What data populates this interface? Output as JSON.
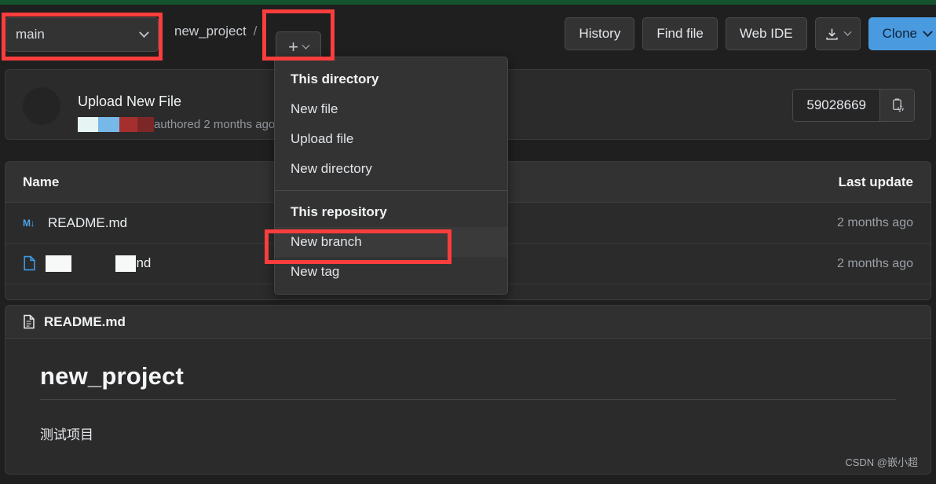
{
  "toolbar": {
    "branch": {
      "value": "main",
      "icon": "chevron-down-icon"
    },
    "breadcrumb": {
      "project": "new_project",
      "separator": "/"
    },
    "add_button": {
      "plus": "+",
      "icon": "chevron-down-icon"
    },
    "actions": {
      "history": "History",
      "find_file": "Find file",
      "web_ide": "Web IDE",
      "download": "download-icon",
      "clone": "Clone"
    }
  },
  "commit": {
    "title": "Upload New File",
    "authored_text": "authored 2 months ago",
    "author_redacted_colors": [
      "#e6f4f4",
      "#76b8e8",
      "#a52f2f",
      "#7c2727"
    ],
    "sha": "59028669",
    "copy_icon": "clipboard-copy-icon"
  },
  "files": {
    "columns": {
      "name": "Name",
      "last_update": "Last update"
    },
    "rows": [
      {
        "icon": "markdown-icon",
        "name": "README.md",
        "redacted": false,
        "last_update": "2 months ago"
      },
      {
        "icon": "file-icon",
        "name": "nd",
        "redacted": true,
        "last_update": "2 months ago"
      }
    ]
  },
  "readme": {
    "filename": "README.md",
    "file_icon": "document-icon",
    "heading": "new_project",
    "body": "测试项目"
  },
  "menu": {
    "section_directory": "This directory",
    "items_directory": [
      "New file",
      "Upload file",
      "New directory"
    ],
    "section_repository": "This repository",
    "items_repository": [
      "New branch",
      "New tag"
    ],
    "highlighted_item": "New branch"
  },
  "watermark": "CSDN @嵌小超",
  "colors": {
    "page_bg": "#1f1f1f",
    "card_bg": "#2b2b2b",
    "accent_blue": "#4a9ae0",
    "annotation_red": "#fc3d3d",
    "top_strip_green": "#14532d"
  }
}
